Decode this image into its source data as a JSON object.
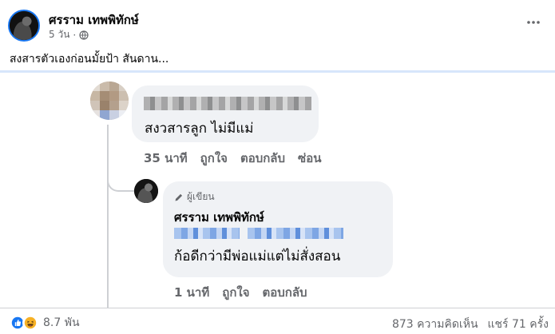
{
  "post": {
    "author": "ศรราม เทพพิทักษ์",
    "time": "5 วัน",
    "separator": "·",
    "text": "สงสารตัวเองก่อนมั้ยป้า สันดาน..."
  },
  "comments": [
    {
      "text": "สงวสารลูก ไม่มีแม่",
      "actions": {
        "time": "35 นาที",
        "like": "ถูกใจ",
        "reply": "ตอบกลับ",
        "hide": "ซ่อน"
      }
    },
    {
      "badge": "ผู้เขียน",
      "author": "ศรราม เทพพิทักษ์",
      "text": "ก้อดีกว่ามีพ่อแม่แต่ไม่สั่งสอน",
      "actions": {
        "time": "1 นาที",
        "like": "ถูกใจ",
        "reply": "ตอบกลับ"
      }
    }
  ],
  "footer": {
    "reaction_icons": [
      "like-icon",
      "haha-icon"
    ],
    "reaction_count": "8.7 พัน",
    "comment_count": "873 ความคิดเห็น",
    "share_count": "แชร์ 71 ครั้ง"
  },
  "colors": {
    "accent": "#1877f2",
    "secondary_text": "#65676b",
    "bubble": "#f0f2f5",
    "haha_yellow": "#f7b125"
  }
}
